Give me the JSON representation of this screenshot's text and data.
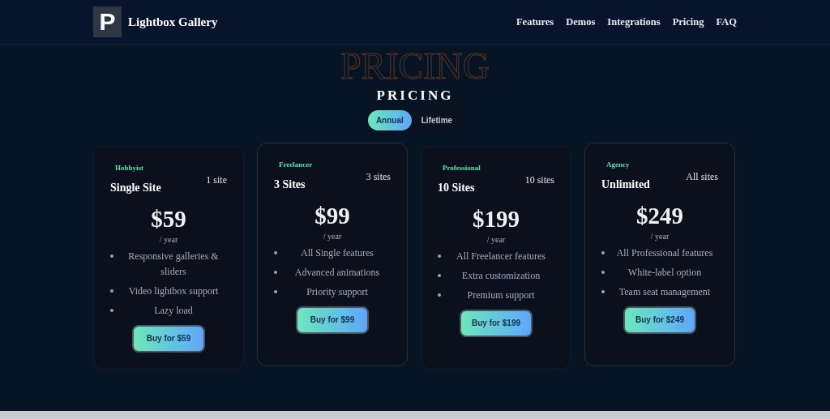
{
  "header": {
    "logo_letter": "P",
    "brand": "Lightbox Gallery",
    "nav": [
      "Features",
      "Demos",
      "Integrations",
      "Pricing",
      "FAQ"
    ]
  },
  "section": {
    "backdrop_text": "PRICING",
    "title": "PRICING"
  },
  "billing_toggle": [
    {
      "label": "Annual",
      "selected": true
    },
    {
      "label": "Lifetime",
      "selected": false
    }
  ],
  "plans": [
    {
      "tier": "Hobbyist",
      "name": "Single Site",
      "sites": "1 site",
      "price": "$59",
      "period": "/ year",
      "features": [
        "Responsive galleries & sliders",
        "Video lightbox support",
        "Lazy load"
      ],
      "button": "Buy for $59"
    },
    {
      "tier": "Freelancer",
      "name": "3 Sites",
      "sites": "3 sites",
      "price": "$99",
      "period": "/ year",
      "features": [
        "All Single features",
        "Advanced animations",
        "Priority support"
      ],
      "button": "Buy for $99"
    },
    {
      "tier": "Professional",
      "name": "10 Sites",
      "sites": "10 sites",
      "price": "$199",
      "period": "/ year",
      "features": [
        "All Freelancer features",
        "Extra customization",
        "Premium support"
      ],
      "button": "Buy for $199"
    },
    {
      "tier": "Agency",
      "name": "Unlimited",
      "sites": "All sites",
      "price": "$249",
      "period": "/ year",
      "features": [
        "All Professional features",
        "White-label option",
        "Team seat management"
      ],
      "button": "Buy for $249"
    }
  ]
}
